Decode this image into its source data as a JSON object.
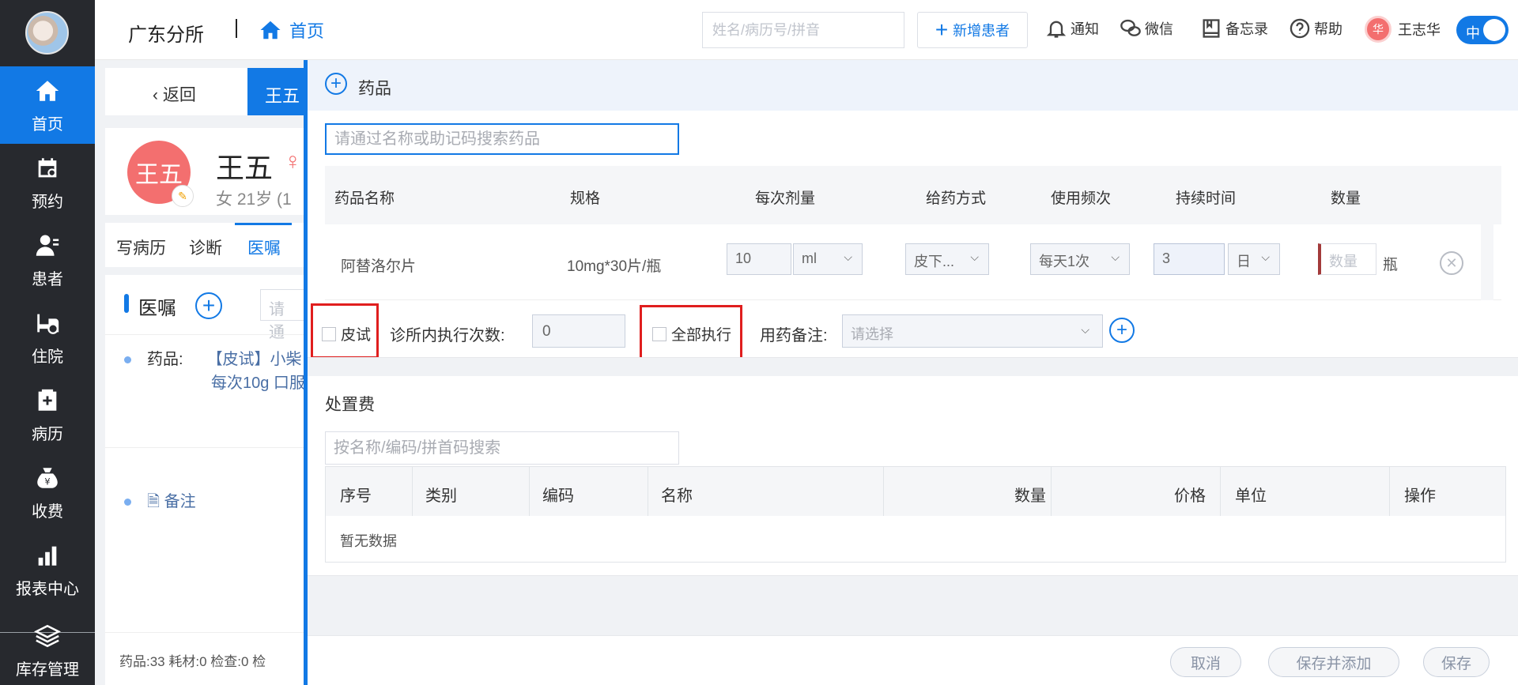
{
  "nav": {
    "items": [
      {
        "label": "首页",
        "icon": "home-icon"
      },
      {
        "label": "预约",
        "icon": "calendar-icon"
      },
      {
        "label": "患者",
        "icon": "user-icon"
      },
      {
        "label": "住院",
        "icon": "bed-icon"
      },
      {
        "label": "病历",
        "icon": "medical-record-icon"
      },
      {
        "label": "收费",
        "icon": "money-bag-icon"
      },
      {
        "label": "报表中心",
        "icon": "bar-chart-icon"
      },
      {
        "label": "库存管理",
        "icon": "layers-icon"
      }
    ]
  },
  "header": {
    "clinic": "广东分所",
    "home": "首页",
    "search_placeholder": "姓名/病历号/拼音",
    "add_patient": "新增患者",
    "notify": "通知",
    "wechat": "微信",
    "memo": "备忘录",
    "help": "帮助",
    "user_avatar": "华",
    "user_name": "王志华",
    "lang": "中"
  },
  "patient": {
    "back": "返回",
    "tab_name": "王五",
    "avatar": "王五",
    "name": "王五",
    "meta": "女  21岁  (1",
    "tabs": [
      "写病历",
      "诊断",
      "医嘱"
    ],
    "orders_title": "医嘱",
    "orders_search": "请通",
    "order_label": "药品:",
    "order_value": "【皮试】小柴",
    "order_line2": "每次10g  口服",
    "note": "备注",
    "footer": "药品:33   耗材:0   检查:0   检"
  },
  "drawer": {
    "title": "药品",
    "drug_search_placeholder": "请通过名称或助记码搜索药品",
    "columns": [
      "药品名称",
      "规格",
      "每次剂量",
      "给药方式",
      "使用频次",
      "持续时间",
      "数量"
    ],
    "row": {
      "name": "阿替洛尔片",
      "spec": "10mg*30片/瓶",
      "dose": "10",
      "dose_unit": "ml",
      "route": "皮下...",
      "freq": "每天1次",
      "duration": "3",
      "duration_unit": "日",
      "qty_placeholder": "数量",
      "qty_unit": "瓶"
    },
    "skin_test": "皮试",
    "exec_label": "诊所内执行次数:",
    "exec_value": "0",
    "all_exec": "全部执行",
    "note_label": "用药备注:",
    "note_placeholder": "请选择",
    "fee_title": "处置费",
    "fee_search_placeholder": "按名称/编码/拼首码搜索",
    "fee_columns": [
      "序号",
      "类别",
      "编码",
      "名称",
      "数量",
      "价格",
      "单位",
      "操作"
    ],
    "fee_empty": "暂无数据",
    "cancel": "取消",
    "save_add": "保存并添加",
    "save": "保存"
  },
  "colors": {
    "primary": "#1279e5",
    "sidebar": "#27292e",
    "highlight": "#e01e1e",
    "avatar": "#f36f6f"
  }
}
